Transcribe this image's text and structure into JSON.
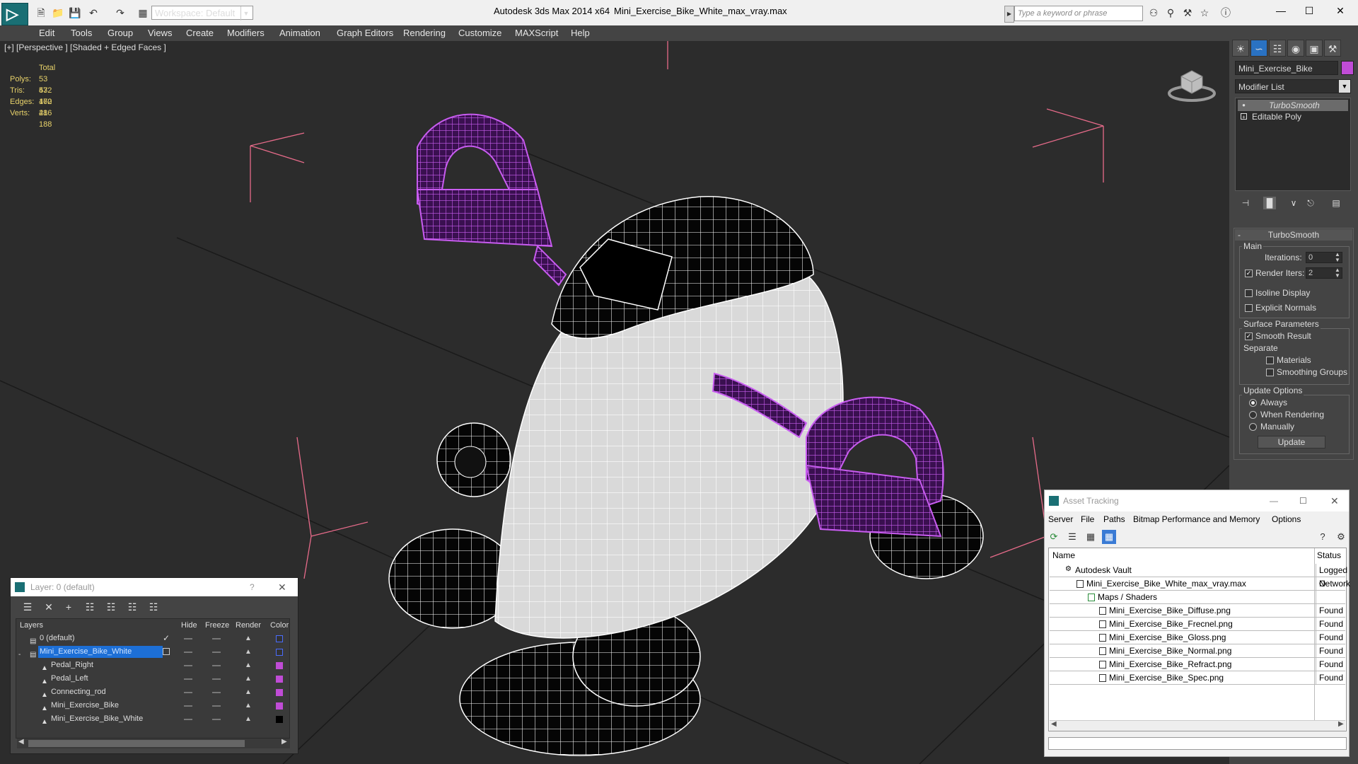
{
  "window": {
    "app_title": "Autodesk 3ds Max  2014 x64",
    "file_title": "Mini_Exercise_Bike_White_max_vray.max",
    "workspace": "Workspace: Default",
    "search_placeholder": "Type a keyword or phrase"
  },
  "menu": [
    "Edit",
    "Tools",
    "Group",
    "Views",
    "Create",
    "Modifiers",
    "Animation",
    "Graph Editors",
    "Rendering",
    "Customize",
    "MAXScript",
    "Help"
  ],
  "viewport": {
    "label": "[+] [Perspective ] [Shaded + Edged Faces ]",
    "stats": {
      "header": "Total",
      "rows": [
        {
          "k": "Polys:",
          "v": "53 472"
        },
        {
          "k": "Tris:",
          "v": "53 472"
        },
        {
          "k": "Edges:",
          "v": "160 416"
        },
        {
          "k": "Verts:",
          "v": "28 188"
        }
      ]
    }
  },
  "command_panel": {
    "object_name": "Mini_Exercise_Bike",
    "object_color": "#c04cd6",
    "modifier_list": "Modifier List",
    "stack": [
      "TurboSmooth",
      "Editable Poly"
    ],
    "rollout_title": "TurboSmooth",
    "main_group": "Main",
    "iterations_label": "Iterations:",
    "iterations_value": "0",
    "render_iters_label": "Render Iters:",
    "render_iters_value": "2",
    "isoline": "Isoline Display",
    "explicit_normals": "Explicit Normals",
    "surface_group": "Surface Parameters",
    "smooth_result": "Smooth Result",
    "separate": "Separate",
    "materials": "Materials",
    "smoothing_groups": "Smoothing Groups",
    "update_group": "Update Options",
    "always": "Always",
    "when_rendering": "When Rendering",
    "manually": "Manually",
    "update_button": "Update"
  },
  "layer_window": {
    "title": "Layer: 0 (default)",
    "help": "?",
    "columns": {
      "layers": "Layers",
      "hide": "Hide",
      "freeze": "Freeze",
      "render": "Render",
      "color": "Color"
    },
    "rows": [
      {
        "name": "0 (default)",
        "color": "#4a6cff"
      },
      {
        "name": "Mini_Exercise_Bike_White",
        "color": "#4a6cff"
      },
      {
        "name": "Pedal_Right",
        "color": "#c04cd6"
      },
      {
        "name": "Pedal_Left",
        "color": "#c04cd6"
      },
      {
        "name": "Connecting_rod",
        "color": "#c04cd6"
      },
      {
        "name": "Mini_Exercise_Bike",
        "color": "#c04cd6"
      },
      {
        "name": "Mini_Exercise_Bike_White",
        "color": "#000000"
      }
    ]
  },
  "asset_tracking": {
    "title": "Asset Tracking",
    "menu": [
      "Server",
      "File",
      "Paths",
      "Bitmap Performance and Memory",
      "Options"
    ],
    "columns": {
      "name": "Name",
      "status": "Status"
    },
    "rows": [
      {
        "name": "Autodesk Vault",
        "status": "Logged O"
      },
      {
        "name": "Mini_Exercise_Bike_White_max_vray.max",
        "status": "Network"
      },
      {
        "name": "Maps / Shaders",
        "status": ""
      },
      {
        "name": "Mini_Exercise_Bike_Diffuse.png",
        "status": "Found"
      },
      {
        "name": "Mini_Exercise_Bike_Frecnel.png",
        "status": "Found"
      },
      {
        "name": "Mini_Exercise_Bike_Gloss.png",
        "status": "Found"
      },
      {
        "name": "Mini_Exercise_Bike_Normal.png",
        "status": "Found"
      },
      {
        "name": "Mini_Exercise_Bike_Refract.png",
        "status": "Found"
      },
      {
        "name": "Mini_Exercise_Bike_Spec.png",
        "status": "Found"
      }
    ]
  }
}
